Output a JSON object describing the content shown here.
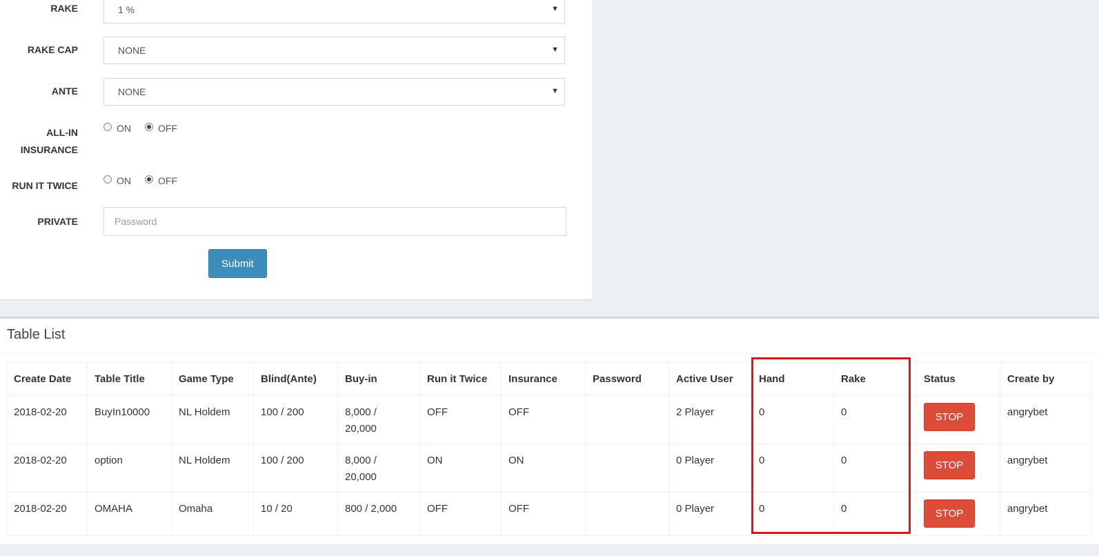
{
  "form": {
    "rake": {
      "label": "RAKE",
      "value": "1 %"
    },
    "rake_cap": {
      "label": "RAKE CAP",
      "value": "NONE"
    },
    "ante": {
      "label": "ANTE",
      "value": "NONE"
    },
    "allin_insurance": {
      "label_line1": "ALL-IN",
      "label_line2": "INSURANCE",
      "on_label": "ON",
      "off_label": "OFF",
      "selected": "OFF"
    },
    "run_it_twice": {
      "label": "RUN IT TWICE",
      "on_label": "ON",
      "off_label": "OFF",
      "selected": "OFF"
    },
    "private": {
      "label": "PRIVATE",
      "placeholder": "Password"
    },
    "submit_label": "Submit"
  },
  "table_list": {
    "title": "Table List",
    "columns": [
      "Create Date",
      "Table Title",
      "Game Type",
      "Blind(Ante)",
      "Buy-in",
      "Run it Twice",
      "Insurance",
      "Password",
      "Active User",
      "Hand",
      "Rake",
      "Status",
      "Create by"
    ],
    "rows": [
      {
        "create_date": "2018-02-20",
        "table_title": "BuyIn10000",
        "game_type": "NL Holdem",
        "blind": "100 / 200",
        "buyin_line1": "8,000 /",
        "buyin_line2": "20,000",
        "run_it_twice": "OFF",
        "insurance": "OFF",
        "password": "",
        "active_user": "2 Player",
        "hand": "0",
        "rake": "0",
        "status_button": "STOP",
        "create_by": "angrybet"
      },
      {
        "create_date": "2018-02-20",
        "table_title": "option",
        "game_type": "NL Holdem",
        "blind": "100 / 200",
        "buyin_line1": "8,000 /",
        "buyin_line2": "20,000",
        "run_it_twice": "ON",
        "insurance": "ON",
        "password": "",
        "active_user": "0 Player",
        "hand": "0",
        "rake": "0",
        "status_button": "STOP",
        "create_by": "angrybet"
      },
      {
        "create_date": "2018-02-20",
        "table_title": "OMAHA",
        "game_type": "Omaha",
        "blind": "10 / 20",
        "buyin_line1": "800 / 2,000",
        "buyin_line2": "",
        "run_it_twice": "OFF",
        "insurance": "OFF",
        "password": "",
        "active_user": "0 Player",
        "hand": "0",
        "rake": "0",
        "status_button": "STOP",
        "create_by": "angrybet"
      }
    ]
  },
  "colors": {
    "primary_button": "#3c8dbc",
    "danger_button": "#dd4b39",
    "highlight": "#e0151b",
    "page_bg": "#ecf0f5"
  }
}
